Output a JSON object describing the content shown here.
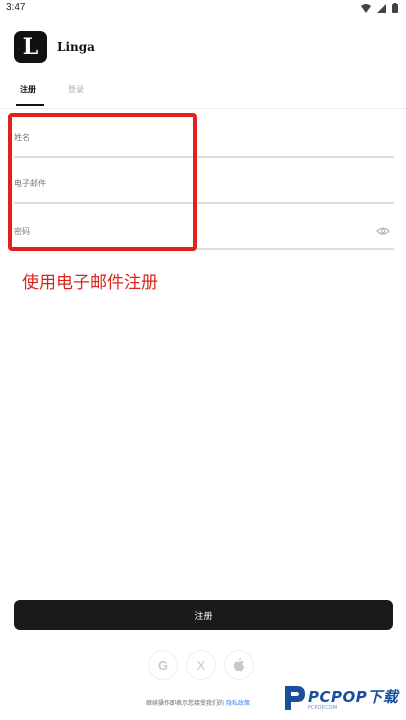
{
  "status_bar": {
    "time": "3:47"
  },
  "app": {
    "logo_letter": "L",
    "name": "Linga"
  },
  "tabs": [
    {
      "label": "注册",
      "active": true
    },
    {
      "label": "登录",
      "active": false
    }
  ],
  "form": {
    "name_label": "姓名",
    "email_label": "电子邮件",
    "password_label": "密码"
  },
  "annotation": {
    "text": "使用电子邮件注册",
    "color": "#e0231a"
  },
  "submit": {
    "label": "注册"
  },
  "social": [
    {
      "icon": "google-icon",
      "glyph": "G"
    },
    {
      "icon": "x-icon",
      "glyph": "X"
    },
    {
      "icon": "apple-icon",
      "glyph": ""
    }
  ],
  "terms": {
    "text": "继续操作即表示您接受我们的",
    "link": "隐私政策"
  },
  "watermark": {
    "brand": "PCPOP下载",
    "sub": "PCPOP.COM"
  }
}
